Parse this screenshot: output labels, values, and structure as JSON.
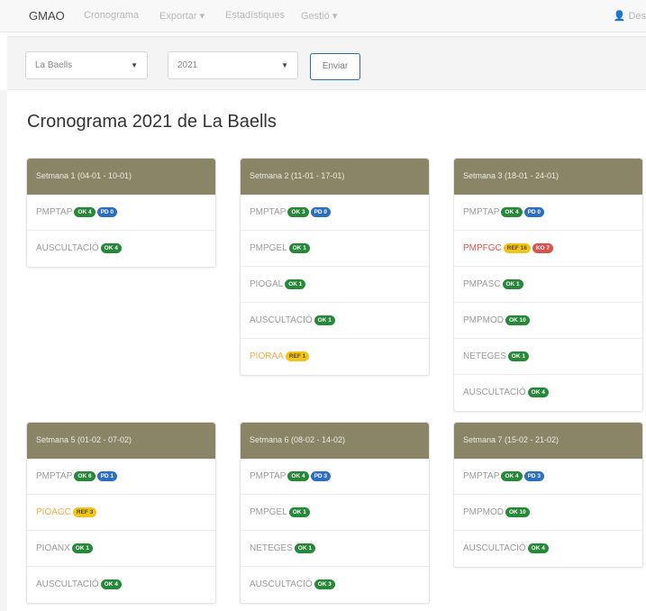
{
  "navbar": {
    "brand": "GMAO",
    "items": [
      {
        "label": "Cronograma"
      },
      {
        "label": "Exportar ▾"
      },
      {
        "label": "Estadístiques"
      },
      {
        "label": "Gestió ▾"
      }
    ],
    "user_label": "Des"
  },
  "filters": {
    "dam_value": "La Baells",
    "year_value": "2021",
    "submit_label": "Enviar"
  },
  "page_title": "Cronograma 2021 de La Baells",
  "colors": {
    "panel_header": "#8a8567",
    "ok_badge": "#27883a",
    "pd_badge": "#2c6ec0",
    "ref_badge": "#f0c419",
    "ko_badge": "#d9534f"
  },
  "weeks": [
    {
      "title": "Setmana 1 (04-01 - 10-01)",
      "rows": [
        {
          "name": "PMPTAP",
          "status": "normal",
          "badges": [
            {
              "kind": "ok",
              "label": "OK 4"
            },
            {
              "kind": "pd",
              "label": "PD 0"
            }
          ]
        },
        {
          "name": "AUSCULTACIÓ",
          "status": "normal",
          "badges": [
            {
              "kind": "ok",
              "label": "OK 4"
            }
          ]
        }
      ]
    },
    {
      "title": "Setmana 2 (11-01 - 17-01)",
      "rows": [
        {
          "name": "PMPTAP",
          "status": "normal",
          "badges": [
            {
              "kind": "ok",
              "label": "OK 3"
            },
            {
              "kind": "pd",
              "label": "PD 0"
            }
          ]
        },
        {
          "name": "PMPGEL",
          "status": "normal",
          "badges": [
            {
              "kind": "ok",
              "label": "OK 1"
            }
          ]
        },
        {
          "name": "PIOGAL",
          "status": "normal",
          "badges": [
            {
              "kind": "ok",
              "label": "OK 1"
            }
          ]
        },
        {
          "name": "AUSCULTACIÓ",
          "status": "normal",
          "badges": [
            {
              "kind": "ok",
              "label": "OK 1"
            }
          ]
        },
        {
          "name": "PIORAA",
          "status": "warn",
          "badges": [
            {
              "kind": "ref",
              "label": "REF 1"
            }
          ]
        }
      ]
    },
    {
      "title": "Setmana 3 (18-01 - 24-01)",
      "rows": [
        {
          "name": "PMPTAP",
          "status": "normal",
          "badges": [
            {
              "kind": "ok",
              "label": "OK 4"
            },
            {
              "kind": "pd",
              "label": "PD 0"
            }
          ]
        },
        {
          "name": "PMPFGC",
          "status": "err",
          "badges": [
            {
              "kind": "ref",
              "label": "REF 16"
            },
            {
              "kind": "ko",
              "label": "KO 7"
            }
          ]
        },
        {
          "name": "PMPASC",
          "status": "normal",
          "badges": [
            {
              "kind": "ok",
              "label": "OK 1"
            }
          ]
        },
        {
          "name": "PMPMOD",
          "status": "normal",
          "badges": [
            {
              "kind": "ok",
              "label": "OK 10"
            }
          ]
        },
        {
          "name": "NETEGES",
          "status": "normal",
          "badges": [
            {
              "kind": "ok",
              "label": "OK 1"
            }
          ]
        },
        {
          "name": "AUSCULTACIÓ",
          "status": "normal",
          "badges": [
            {
              "kind": "ok",
              "label": "OK 4"
            }
          ]
        }
      ]
    },
    {
      "title": "Setmana 5 (01-02 - 07-02)",
      "rows": [
        {
          "name": "PMPTAP",
          "status": "normal",
          "badges": [
            {
              "kind": "ok",
              "label": "OK 6"
            },
            {
              "kind": "pd",
              "label": "PD 1"
            }
          ]
        },
        {
          "name": "PIOAGC",
          "status": "warn",
          "badges": [
            {
              "kind": "ref",
              "label": "REF 3"
            }
          ]
        },
        {
          "name": "PIOANX",
          "status": "normal",
          "badges": [
            {
              "kind": "ok",
              "label": "OK 1"
            }
          ]
        },
        {
          "name": "AUSCULTACIÓ",
          "status": "normal",
          "badges": [
            {
              "kind": "ok",
              "label": "OK 4"
            }
          ]
        }
      ]
    },
    {
      "title": "Setmana 6 (08-02 - 14-02)",
      "rows": [
        {
          "name": "PMPTAP",
          "status": "normal",
          "badges": [
            {
              "kind": "ok",
              "label": "OK 4"
            },
            {
              "kind": "pd",
              "label": "PD 3"
            }
          ]
        },
        {
          "name": "PMPGEL",
          "status": "normal",
          "badges": [
            {
              "kind": "ok",
              "label": "OK 1"
            }
          ]
        },
        {
          "name": "NETEGES",
          "status": "normal",
          "badges": [
            {
              "kind": "ok",
              "label": "OK 1"
            }
          ]
        },
        {
          "name": "AUSCULTACIÓ",
          "status": "normal",
          "badges": [
            {
              "kind": "ok",
              "label": "OK 3"
            }
          ]
        }
      ]
    },
    {
      "title": "Setmana 7 (15-02 - 21-02)",
      "rows": [
        {
          "name": "PMPTAP",
          "status": "normal",
          "badges": [
            {
              "kind": "ok",
              "label": "OK 4"
            },
            {
              "kind": "pd",
              "label": "PD 3"
            }
          ]
        },
        {
          "name": "PMPMOD",
          "status": "normal",
          "badges": [
            {
              "kind": "ok",
              "label": "OK 10"
            }
          ]
        },
        {
          "name": "AUSCULTACIÓ",
          "status": "normal",
          "badges": [
            {
              "kind": "ok",
              "label": "OK 4"
            }
          ]
        }
      ]
    }
  ]
}
